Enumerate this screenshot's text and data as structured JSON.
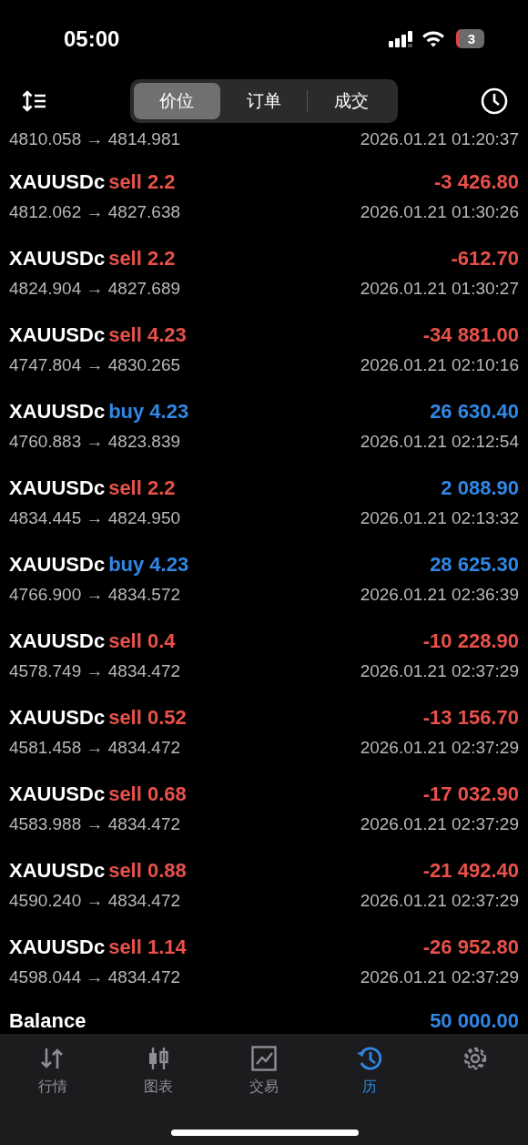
{
  "status_bar": {
    "time": "05:00",
    "battery": "3"
  },
  "header": {
    "segments": [
      {
        "label": "价位",
        "selected": true
      },
      {
        "label": "订单",
        "selected": false
      },
      {
        "label": "成交",
        "selected": false
      }
    ]
  },
  "partial_row": {
    "prices": "4810.058 → 4814.981",
    "time": "2026.01.21 01:20:37"
  },
  "deals": [
    {
      "symbol": "XAUUSDc",
      "kind": "sell",
      "side": "sell 2.2",
      "profit": "-3 426.80",
      "gain": false,
      "prices": "4812.062 → 4827.638",
      "time": "2026.01.21 01:30:26"
    },
    {
      "symbol": "XAUUSDc",
      "kind": "sell",
      "side": "sell 2.2",
      "profit": "-612.70",
      "gain": false,
      "prices": "4824.904 → 4827.689",
      "time": "2026.01.21 01:30:27"
    },
    {
      "symbol": "XAUUSDc",
      "kind": "sell",
      "side": "sell 4.23",
      "profit": "-34 881.00",
      "gain": false,
      "prices": "4747.804 → 4830.265",
      "time": "2026.01.21 02:10:16"
    },
    {
      "symbol": "XAUUSDc",
      "kind": "buy",
      "side": "buy 4.23",
      "profit": "26 630.40",
      "gain": true,
      "prices": "4760.883 → 4823.839",
      "time": "2026.01.21 02:12:54"
    },
    {
      "symbol": "XAUUSDc",
      "kind": "sell",
      "side": "sell 2.2",
      "profit": "2 088.90",
      "gain": true,
      "prices": "4834.445 → 4824.950",
      "time": "2026.01.21 02:13:32"
    },
    {
      "symbol": "XAUUSDc",
      "kind": "buy",
      "side": "buy 4.23",
      "profit": "28 625.30",
      "gain": true,
      "prices": "4766.900 → 4834.572",
      "time": "2026.01.21 02:36:39"
    },
    {
      "symbol": "XAUUSDc",
      "kind": "sell",
      "side": "sell 0.4",
      "profit": "-10 228.90",
      "gain": false,
      "prices": "4578.749 → 4834.472",
      "time": "2026.01.21 02:37:29"
    },
    {
      "symbol": "XAUUSDc",
      "kind": "sell",
      "side": "sell 0.52",
      "profit": "-13 156.70",
      "gain": false,
      "prices": "4581.458 → 4834.472",
      "time": "2026.01.21 02:37:29"
    },
    {
      "symbol": "XAUUSDc",
      "kind": "sell",
      "side": "sell 0.68",
      "profit": "-17 032.90",
      "gain": false,
      "prices": "4583.988 → 4834.472",
      "time": "2026.01.21 02:37:29"
    },
    {
      "symbol": "XAUUSDc",
      "kind": "sell",
      "side": "sell 0.88",
      "profit": "-21 492.40",
      "gain": false,
      "prices": "4590.240 → 4834.472",
      "time": "2026.01.21 02:37:29"
    },
    {
      "symbol": "XAUUSDc",
      "kind": "sell",
      "side": "sell 1.14",
      "profit": "-26 952.80",
      "gain": false,
      "prices": "4598.044 → 4834.472",
      "time": "2026.01.21 02:37:29"
    }
  ],
  "balance": {
    "label": "Balance",
    "value": "50 000.00"
  },
  "tab_bar": [
    {
      "kind": "quotes",
      "label": "行情",
      "selected": false
    },
    {
      "kind": "chart",
      "label": "图表",
      "selected": false
    },
    {
      "kind": "trade",
      "label": "交易",
      "selected": false
    },
    {
      "kind": "history",
      "label": "历",
      "selected": true
    },
    {
      "kind": "settings",
      "selected": false
    }
  ]
}
